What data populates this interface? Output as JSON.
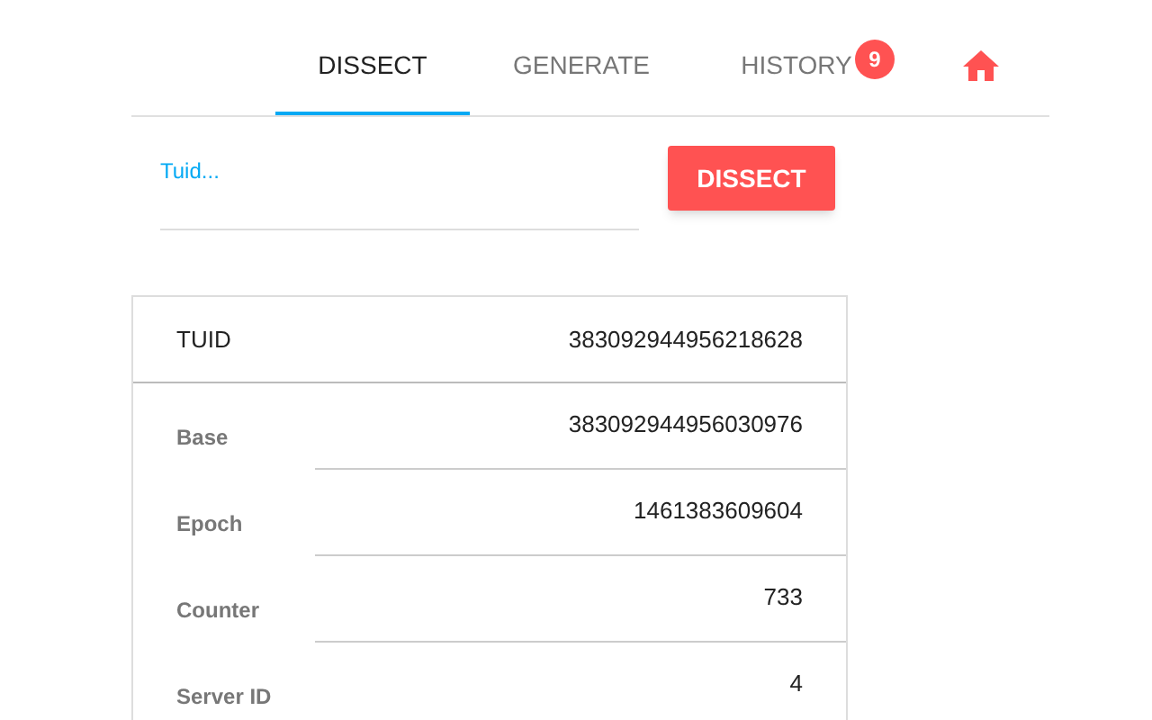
{
  "tabs": [
    {
      "label": "DISSECT",
      "selected": true
    },
    {
      "label": "GENERATE",
      "selected": false
    },
    {
      "label": "HISTORY",
      "selected": false,
      "badge": "9"
    }
  ],
  "input": {
    "placeholder": "Tuid..."
  },
  "button": "DISSECT",
  "result": {
    "label": "TUID",
    "value": "383092944956218628"
  },
  "fields": [
    {
      "label": "Base",
      "value": "383092944956030976"
    },
    {
      "label": "Epoch",
      "value": "1461383609604"
    },
    {
      "label": "Counter",
      "value": "733"
    },
    {
      "label": "Server ID",
      "value": "4"
    }
  ]
}
